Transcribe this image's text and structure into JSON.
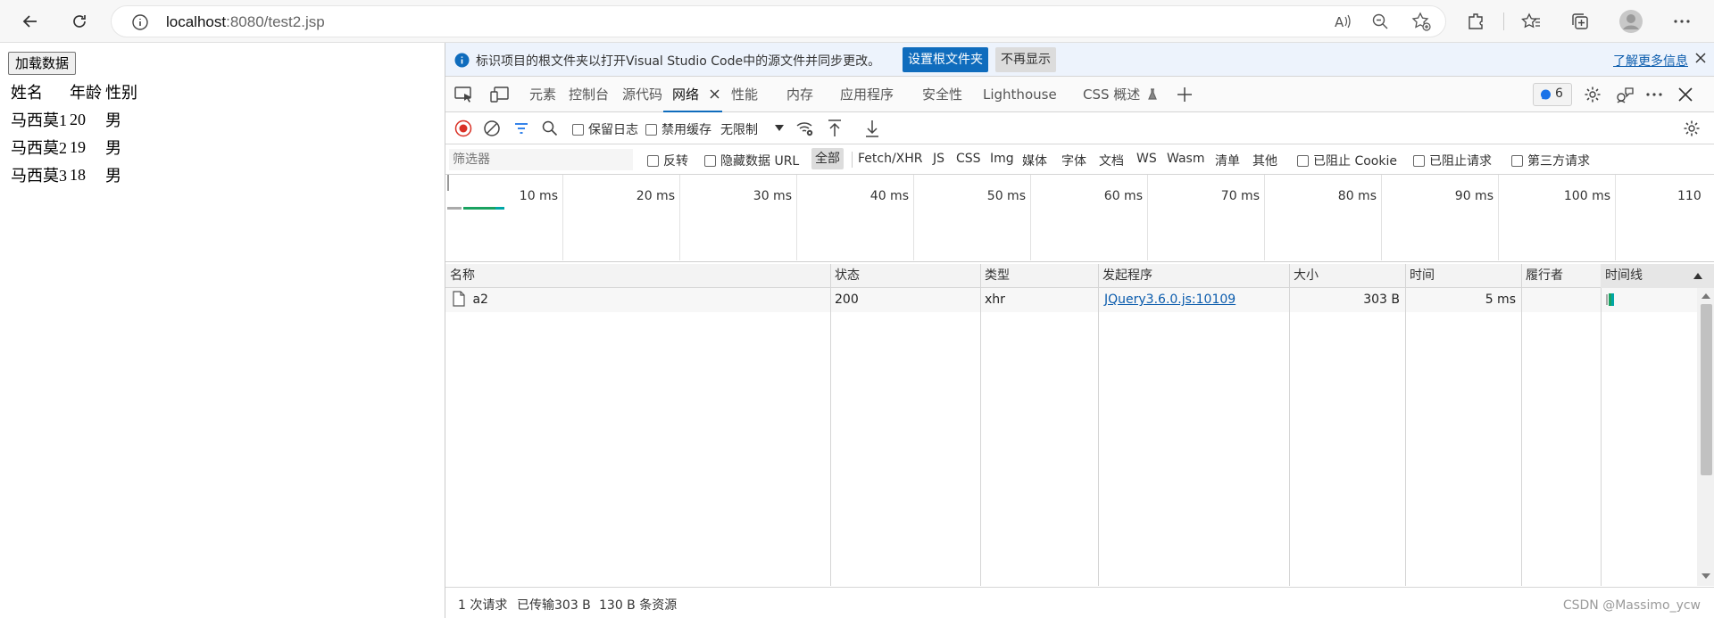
{
  "browser": {
    "url_host": "localhost",
    "url_rest": ":8080/test2.jsp"
  },
  "page": {
    "load_button": "加载数据",
    "headers": [
      "姓名",
      "年龄",
      "性别"
    ],
    "rows": [
      [
        "马西莫1",
        "20",
        "男"
      ],
      [
        "马西莫2",
        "19",
        "男"
      ],
      [
        "马西莫3",
        "18",
        "男"
      ]
    ]
  },
  "devtools": {
    "infobar": {
      "message": "标识项目的根文件夹以打开Visual Studio Code中的源文件并同步更改。",
      "set_root": "设置根文件夹",
      "dont_show": "不再显示",
      "learn_more": "了解更多信息"
    },
    "tabs": [
      "元素",
      "控制台",
      "源代码",
      "网络",
      "性能",
      "内存",
      "应用程序",
      "安全性",
      "Lighthouse",
      "CSS 概述"
    ],
    "issues_count": "6",
    "toolbar": {
      "preserve_log": "保留日志",
      "disable_cache": "禁用缓存",
      "throttle": "无限制"
    },
    "filter": {
      "placeholder": "筛选器",
      "invert": "反转",
      "hide_data_urls": "隐藏数据 URL",
      "types": [
        "全部",
        "Fetch/XHR",
        "JS",
        "CSS",
        "Img",
        "媒体",
        "字体",
        "文档",
        "WS",
        "Wasm",
        "清单",
        "其他"
      ],
      "blocked_cookies": "已阻止 Cookie",
      "blocked_requests": "已阻止请求",
      "third_party": "第三方请求"
    },
    "overview_ticks": [
      "10 ms",
      "20 ms",
      "30 ms",
      "40 ms",
      "50 ms",
      "60 ms",
      "70 ms",
      "80 ms",
      "90 ms",
      "100 ms",
      "110"
    ],
    "columns": [
      "名称",
      "状态",
      "类型",
      "发起程序",
      "大小",
      "时间",
      "履行者",
      "时间线"
    ],
    "requests": [
      {
        "name": "a2",
        "status": "200",
        "type": "xhr",
        "initiator": "JQuery3.6.0.js:10109",
        "size": "303 B",
        "time": "5 ms",
        "fulfilled_by": ""
      }
    ],
    "status": {
      "requests": "1 次请求",
      "transferred": "已传输303 B",
      "resources": "130 B 条资源"
    },
    "watermark": "CSDN @Massimo_ycw"
  },
  "colors": {
    "accent": "#0f6cbd",
    "record_red": "#d93025",
    "waterfall_green": "#1aa260",
    "waterfall_teal": "#00a6a6"
  }
}
